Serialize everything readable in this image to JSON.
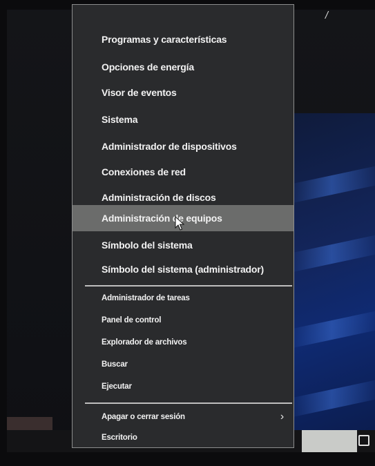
{
  "menu": {
    "group1": [
      {
        "label": "Programas y características"
      },
      {
        "label": "Opciones de energía"
      },
      {
        "label": "Visor de eventos"
      },
      {
        "label": "Sistema"
      },
      {
        "label": "Administrador de dispositivos"
      },
      {
        "label": "Conexiones de red"
      },
      {
        "label": "Administración de discos"
      },
      {
        "label": "Administración de equipos"
      },
      {
        "label": "Símbolo del sistema"
      },
      {
        "label": "Símbolo del sistema (administrador)"
      }
    ],
    "group2": [
      {
        "label": "Administrador de tareas"
      },
      {
        "label": "Panel de control"
      },
      {
        "label": "Explorador de archivos"
      },
      {
        "label": "Buscar"
      },
      {
        "label": "Ejecutar"
      }
    ],
    "group3": [
      {
        "label": "Apagar o cerrar sesión",
        "submenu_indicator": "›"
      },
      {
        "label": "Escritorio"
      }
    ],
    "highlighted_item": "Administración de equipos"
  },
  "desktop": {
    "top_right_fragment": "/"
  },
  "icons": {
    "cursor": "mouse-pointer-icon",
    "submenu": "chevron-right-icon",
    "task_view": "task-view-icon"
  },
  "colors": {
    "menu_background": "#2a2b2d",
    "menu_highlight": "#6b6c6b",
    "menu_border": "#8d8e8e",
    "desktop_accent": "#13255a"
  }
}
